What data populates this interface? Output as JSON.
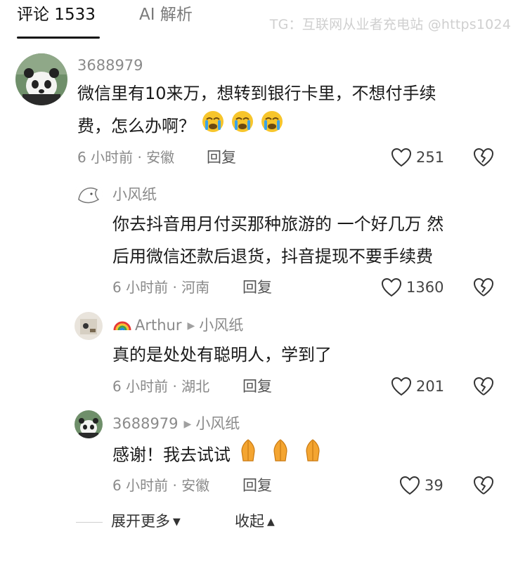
{
  "tabs": {
    "comments_label": "评论 1533",
    "ai_label": "AI 解析"
  },
  "watermark": "TG：互联网从业者充电站 @https1024",
  "comments": [
    {
      "username": "3688979",
      "text_line1": "微信里有10来万，想转到银行卡里，不想付手续",
      "text_line2": "费，怎么办啊？",
      "emoji": [
        "crying-face",
        "crying-face",
        "crying-face"
      ],
      "time_location": "6 小时前 · 安徽",
      "reply_label": "回复",
      "likes": "251"
    },
    {
      "username": "小风纸",
      "text_line1": "你去抖音用月付买那种旅游的 一个好几万 然",
      "text_line2": "后用微信还款后退货，抖音提现不要手续费",
      "time_location": "6 小时前 · 河南",
      "reply_label": "回复",
      "likes": "1360"
    },
    {
      "username": "Arthur",
      "reply_to": "小风纸",
      "text_line1": "真的是处处有聪明人，学到了",
      "time_location": "6 小时前 · 湖北",
      "reply_label": "回复",
      "likes": "201"
    },
    {
      "username": "3688979",
      "reply_to": "小风纸",
      "text_line1": "感谢！我去试试",
      "emoji": [
        "folded-hands",
        "folded-hands",
        "folded-hands"
      ],
      "time_location": "6 小时前 · 安徽",
      "reply_label": "回复",
      "likes": "39"
    }
  ],
  "footer": {
    "expand_label": "展开更多",
    "collapse_label": "收起"
  },
  "colors": {
    "meta_gray": "#8a8a8a",
    "emoji_yellow": "#f7c52b",
    "emoji_tear": "#3ba3e8"
  }
}
